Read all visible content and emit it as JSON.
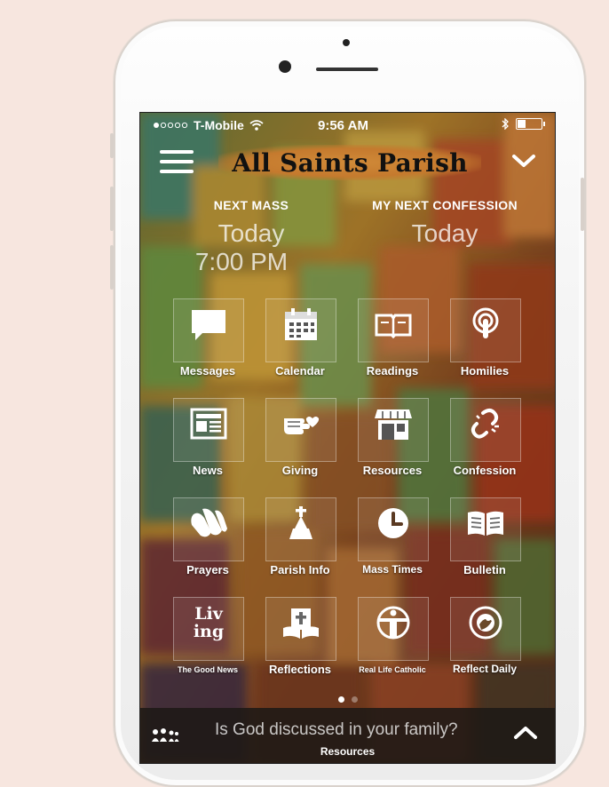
{
  "status": {
    "carrier": "T-Mobile",
    "time": "9:56 AM"
  },
  "header": {
    "title": "All Saints Parish"
  },
  "mass": {
    "next_mass_label": "NEXT MASS",
    "next_mass_day": "Today",
    "next_mass_time": "7:00 PM",
    "confession_label": "MY NEXT CONFESSION",
    "confession_day": "Today"
  },
  "tiles": [
    {
      "label": "Messages",
      "icon": "message-icon"
    },
    {
      "label": "Calendar",
      "icon": "calendar-icon"
    },
    {
      "label": "Readings",
      "icon": "readings-book-icon"
    },
    {
      "label": "Homilies",
      "icon": "podcast-icon"
    },
    {
      "label": "News",
      "icon": "newspaper-icon"
    },
    {
      "label": "Giving",
      "icon": "giving-hand-icon"
    },
    {
      "label": "Resources",
      "icon": "storefront-icon"
    },
    {
      "label": "Confession",
      "icon": "broken-link-icon"
    },
    {
      "label": "Prayers",
      "icon": "praying-hands-icon"
    },
    {
      "label": "Parish Info",
      "icon": "church-icon"
    },
    {
      "label": "Mass Times",
      "icon": "clock-icon"
    },
    {
      "label": "Bulletin",
      "icon": "open-book-icon"
    },
    {
      "label": "The Good News",
      "icon": "living-logo-icon"
    },
    {
      "label": "Reflections",
      "icon": "bible-icon"
    },
    {
      "label": "Real Life Catholic",
      "icon": "christ-statue-icon"
    },
    {
      "label": "Reflect Daily",
      "icon": "reflect-daily-icon"
    }
  ],
  "living_logo": {
    "line1": "Liv",
    "line2": "ing"
  },
  "pager": {
    "active": 0,
    "count": 2
  },
  "bottom": {
    "question": "Is God discussed in your family?",
    "category": "Resources"
  },
  "colors": {
    "bottom_bar": "#1e1916",
    "title_highlight": "#c57a2e"
  }
}
